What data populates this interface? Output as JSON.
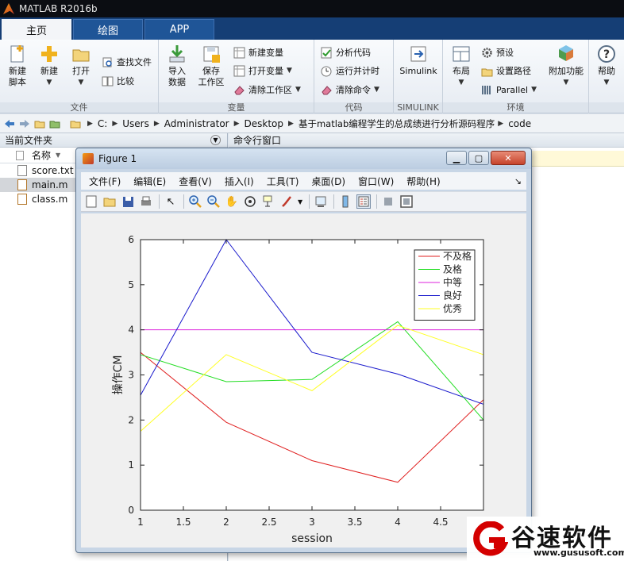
{
  "app": {
    "title": "MATLAB R2016b"
  },
  "tabs": [
    {
      "label": "主页"
    },
    {
      "label": "绘图"
    },
    {
      "label": "APP"
    }
  ],
  "ribbon": {
    "file_group": {
      "label": "文件",
      "new_script": "新建\n脚本",
      "new": "新建",
      "open": "打开",
      "find_files": "查找文件",
      "compare": "比较"
    },
    "variable_group": {
      "label": "变量",
      "import": "导入\n数据",
      "save_ws": "保存\n工作区",
      "new_var": "新建变量",
      "open_var": "打开变量",
      "clear_ws": "清除工作区"
    },
    "code_group": {
      "label": "代码",
      "analyze": "分析代码",
      "run_time": "运行并计时",
      "clear_cmd": "清除命令"
    },
    "simulink_group": {
      "label": "SIMULINK",
      "simulink": "Simulink"
    },
    "env_group": {
      "label": "环境",
      "layout": "布局",
      "prefs": "预设",
      "set_path": "设置路径",
      "parallel": "Parallel",
      "addons": "附加功能"
    },
    "resources_group": {
      "help": "帮助"
    }
  },
  "path": {
    "crumbs": [
      "C:",
      "Users",
      "Administrator",
      "Desktop",
      "基于matlab编程学生的总成绩进行分析源码程序",
      "code"
    ]
  },
  "current_folder": {
    "title": "当前文件夹",
    "column": "名称",
    "files": [
      {
        "name": "score.txt"
      },
      {
        "name": "main.m"
      },
      {
        "name": "class.m"
      }
    ]
  },
  "command_window": {
    "title": "命令行窗口"
  },
  "figure": {
    "title": "Figure 1",
    "menu": [
      "文件(F)",
      "编辑(E)",
      "查看(V)",
      "插入(I)",
      "工具(T)",
      "桌面(D)",
      "窗口(W)",
      "帮助(H)"
    ]
  },
  "chart_data": {
    "type": "line",
    "xlabel": "session",
    "ylabel": "操作CM",
    "xlim": [
      1,
      5
    ],
    "ylim": [
      0,
      6
    ],
    "xticks": [
      1,
      1.5,
      2,
      2.5,
      3,
      3.5,
      4,
      4.5
    ],
    "yticks": [
      0,
      1,
      2,
      3,
      4,
      5,
      6
    ],
    "x": [
      1,
      2,
      3,
      4,
      5
    ],
    "legend": "top-right",
    "grid": false,
    "series": [
      {
        "name": "不及格",
        "color": "#e02020",
        "values": [
          3.5,
          1.95,
          1.1,
          0.62,
          2.45
        ]
      },
      {
        "name": "及格",
        "color": "#22dd22",
        "values": [
          3.45,
          2.85,
          2.9,
          4.18,
          2.0
        ]
      },
      {
        "name": "中等",
        "color": "#dd22dd",
        "values": [
          4.0,
          4.0,
          4.0,
          4.0,
          4.0
        ]
      },
      {
        "name": "良好",
        "color": "#1a1acc",
        "values": [
          2.55,
          6.0,
          3.5,
          3.02,
          2.35
        ]
      },
      {
        "name": "优秀",
        "color": "#ffff22",
        "values": [
          1.75,
          3.45,
          2.65,
          4.1,
          3.45
        ]
      }
    ]
  },
  "watermark": {
    "brand": "谷速软件",
    "url": "www.gususoft.com"
  }
}
